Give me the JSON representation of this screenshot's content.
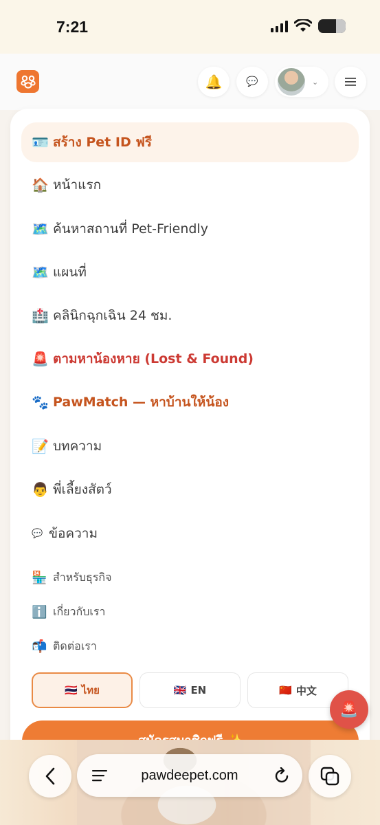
{
  "status_bar": {
    "time": "7:21"
  },
  "header": {
    "logo": "paw-logo",
    "bell_icon": "🔔",
    "chat_icon": "💬"
  },
  "menu": {
    "items": [
      {
        "icon": "🪪",
        "label": "สร้าง Pet ID ฟรี"
      },
      {
        "icon": "🏠",
        "label": "หน้าแรก"
      },
      {
        "icon": "🗺️",
        "label": "ค้นหาสถานที่ Pet-Friendly"
      },
      {
        "icon": "🗺️",
        "label": "แผนที่"
      },
      {
        "icon": "🏥",
        "label": "คลินิกฉุกเฉิน 24 ชม."
      },
      {
        "icon": "🚨",
        "label": "ตามหาน้องหาย (Lost & Found)"
      },
      {
        "icon": "🐾",
        "label": "PawMatch — หาบ้านให้น้อง"
      },
      {
        "icon": "📝",
        "label": "บทความ"
      },
      {
        "icon": "👨",
        "label": "พี่เลี้ยงสัตว์"
      },
      {
        "icon": "💬",
        "label": "ข้อความ"
      }
    ],
    "secondary_items": [
      {
        "icon": "🏪",
        "label": "สำหรับธุรกิจ"
      },
      {
        "icon": "ℹ️",
        "label": "เกี่ยวกับเรา"
      },
      {
        "icon": "📬",
        "label": "ติดต่อเรา"
      }
    ],
    "languages": [
      {
        "flag": "🇹🇭",
        "label": "ไทย",
        "active": true
      },
      {
        "flag": "🇬🇧",
        "label": "EN",
        "active": false
      },
      {
        "flag": "🇨🇳",
        "label": "中文",
        "active": false
      }
    ],
    "signup_label": "สมัครสมาชิกฟรี ✨"
  },
  "sos_icon": "🚨",
  "browser": {
    "url": "pawdeepet.com"
  },
  "colors": {
    "accent": "#ee7c34",
    "highlight_text": "#c5541e",
    "alert_text": "#cc3a33",
    "sos": "#e05248"
  }
}
